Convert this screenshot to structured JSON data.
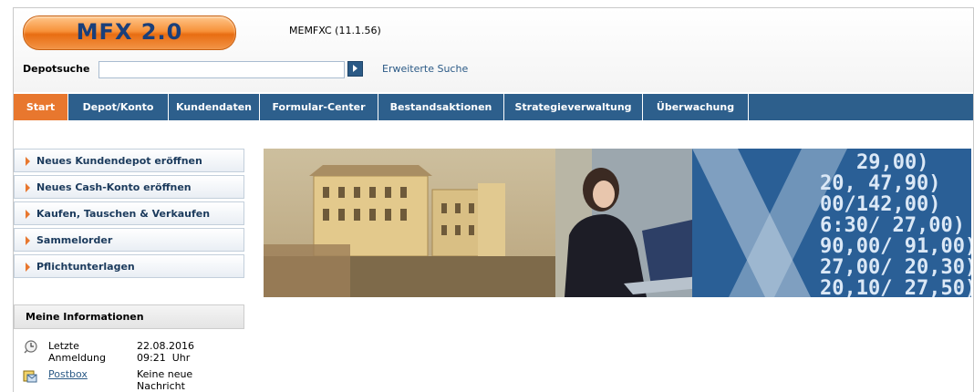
{
  "app": {
    "logo": "MFX 2.0",
    "version": "MEMFXC (11.1.56)"
  },
  "search": {
    "label": "Depotsuche",
    "value": "",
    "placeholder": "",
    "advanced_link": "Erweiterte Suche"
  },
  "nav": {
    "tabs": [
      {
        "label": "Start",
        "active": true
      },
      {
        "label": "Depot/Konto"
      },
      {
        "label": "Kundendaten"
      },
      {
        "label": "Formular-Center"
      },
      {
        "label": "Bestandsaktionen"
      },
      {
        "label": "Strategieverwaltung"
      },
      {
        "label": "Überwachung"
      }
    ]
  },
  "menu": {
    "items": [
      {
        "label": "Neues Kundendepot eröffnen"
      },
      {
        "label": "Neues Cash-Konto eröffnen"
      },
      {
        "label": "Kaufen, Tauschen & Verkaufen"
      },
      {
        "label": "Sammelorder"
      },
      {
        "label": "Pflichtunterlagen"
      }
    ]
  },
  "info": {
    "title": "Meine Informationen",
    "last_login": {
      "label_line1": "Letzte",
      "label_line2": "Anmeldung",
      "date": "22.08.2016",
      "time": "09:21  Uhr"
    },
    "postbox": {
      "label": "Postbox",
      "value_line1": "Keine neue",
      "value_line2": "Nachricht"
    }
  },
  "banner": {
    "ticker_lines": [
      "29,00)",
      "20, 47,90)",
      "00/142,00)",
      "6:30/ 27,00)",
      "90,00/ 91,00)",
      "27,00/ 20,30)",
      "20,10/ 27,50)"
    ]
  },
  "colors": {
    "nav_bg": "#2d5f8c",
    "active_tab": "#e8772e",
    "link": "#2b5a86",
    "logo_orange": "#f7923a"
  }
}
